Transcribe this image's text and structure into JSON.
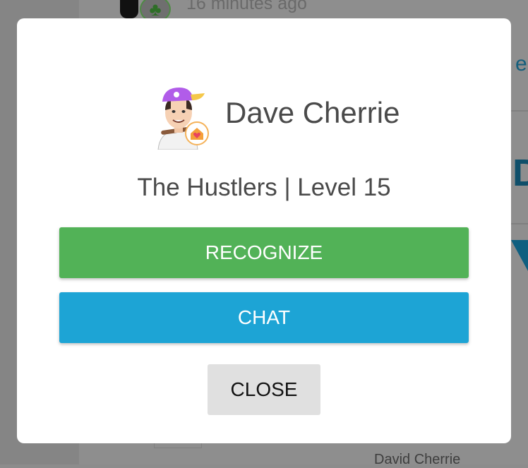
{
  "background": {
    "timestamp": "16 minutes ago",
    "footer_name": "David Cherrie"
  },
  "modal": {
    "user_name": "Dave Cherrie",
    "subtitle": "The Hustlers | Level 15",
    "recognize_label": "RECOGNIZE",
    "chat_label": "CHAT",
    "close_label": "CLOSE"
  },
  "colors": {
    "recognize": "#52b257",
    "chat": "#1da4d5",
    "close": "#e0e0e0"
  },
  "icons": {
    "avatar": "cartoon-avatar-purple-cap",
    "badge": "home-heart-icon"
  }
}
